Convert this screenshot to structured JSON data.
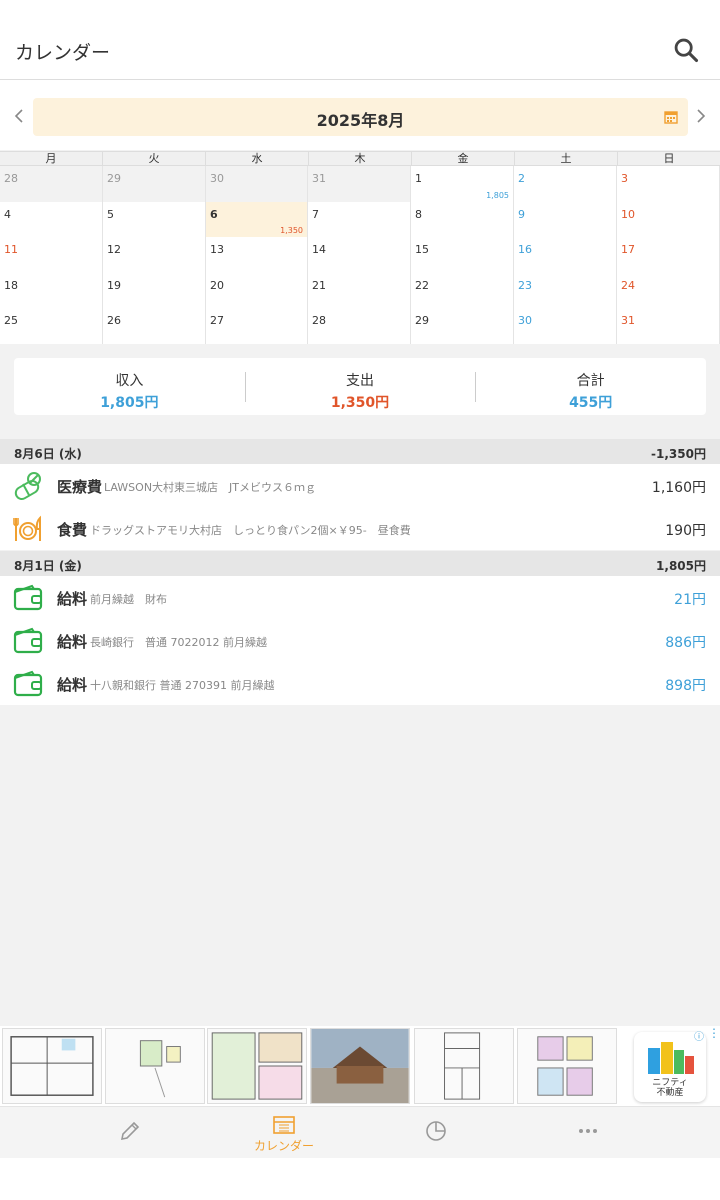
{
  "appbar": {
    "title": "カレンダー",
    "search_icon": "search-icon"
  },
  "month": {
    "label": "2025年8月",
    "prev_icon": "chevron-left-icon",
    "next_icon": "chevron-right-icon",
    "calendar_icon": "calendar-icon"
  },
  "weekdays": [
    "月",
    "火",
    "水",
    "木",
    "金",
    "土",
    "日"
  ],
  "calendar": {
    "weeks": [
      [
        {
          "d": "28",
          "out": true
        },
        {
          "d": "29",
          "out": true
        },
        {
          "d": "30",
          "out": true
        },
        {
          "d": "31",
          "out": true
        },
        {
          "d": "1",
          "amount": "1,805",
          "amount_type": "income"
        },
        {
          "d": "2"
        },
        {
          "d": "3"
        }
      ],
      [
        {
          "d": "4"
        },
        {
          "d": "5"
        },
        {
          "d": "6",
          "today": true,
          "amount": "1,350",
          "amount_type": "expense"
        },
        {
          "d": "7"
        },
        {
          "d": "8"
        },
        {
          "d": "9"
        },
        {
          "d": "10"
        }
      ],
      [
        {
          "d": "11",
          "holiday": true
        },
        {
          "d": "12"
        },
        {
          "d": "13"
        },
        {
          "d": "14"
        },
        {
          "d": "15"
        },
        {
          "d": "16"
        },
        {
          "d": "17"
        }
      ],
      [
        {
          "d": "18"
        },
        {
          "d": "19"
        },
        {
          "d": "20"
        },
        {
          "d": "21"
        },
        {
          "d": "22"
        },
        {
          "d": "23"
        },
        {
          "d": "24"
        }
      ],
      [
        {
          "d": "25"
        },
        {
          "d": "26"
        },
        {
          "d": "27"
        },
        {
          "d": "28"
        },
        {
          "d": "29"
        },
        {
          "d": "30"
        },
        {
          "d": "31"
        }
      ]
    ]
  },
  "summary": {
    "income_label": "収入",
    "income_value": "1,805円",
    "expense_label": "支出",
    "expense_value": "1,350円",
    "total_label": "合計",
    "total_value": "455円"
  },
  "days": [
    {
      "date": "8月6日 (水)",
      "total": "-1,350円",
      "items": [
        {
          "category": "医療費",
          "memo": "LAWSON大村東三城店　JTメビウス６ｍｇ",
          "amount": "1,160円",
          "type": "expense",
          "icon": "medicine-icon"
        },
        {
          "category": "食費",
          "memo": "ドラッグストアモリ大村店　しっとり食パン2個×￥95-　昼食費",
          "amount": "190円",
          "type": "expense",
          "icon": "meal-icon"
        }
      ]
    },
    {
      "date": "8月1日 (金)",
      "total": "1,805円",
      "items": [
        {
          "category": "給料",
          "memo": "前月繰越　財布",
          "amount": "21円",
          "type": "income",
          "icon": "wallet-icon"
        },
        {
          "category": "給料",
          "memo": "長崎銀行　普通 7022012 前月繰越",
          "amount": "886円",
          "type": "income",
          "icon": "wallet-icon"
        },
        {
          "category": "給料",
          "memo": "十八親和銀行 普通 270391 前月繰越",
          "amount": "898円",
          "type": "income",
          "icon": "wallet-icon"
        }
      ]
    }
  ],
  "ad": {
    "brand": "ニフティ不動産",
    "brand_line1": "ニフティ",
    "brand_line2": "不動産"
  },
  "nav": {
    "tabs": [
      {
        "label": "",
        "icon": "pencil-icon"
      },
      {
        "label": "カレンダー",
        "icon": "calendar-icon"
      },
      {
        "label": "",
        "icon": "pie-chart-icon"
      },
      {
        "label": "",
        "icon": "more-icon"
      }
    ]
  },
  "colors": {
    "income": "#3ea0d8",
    "expense": "#e0552a",
    "accent": "#f0a030",
    "highlight": "#fdf2dc"
  }
}
